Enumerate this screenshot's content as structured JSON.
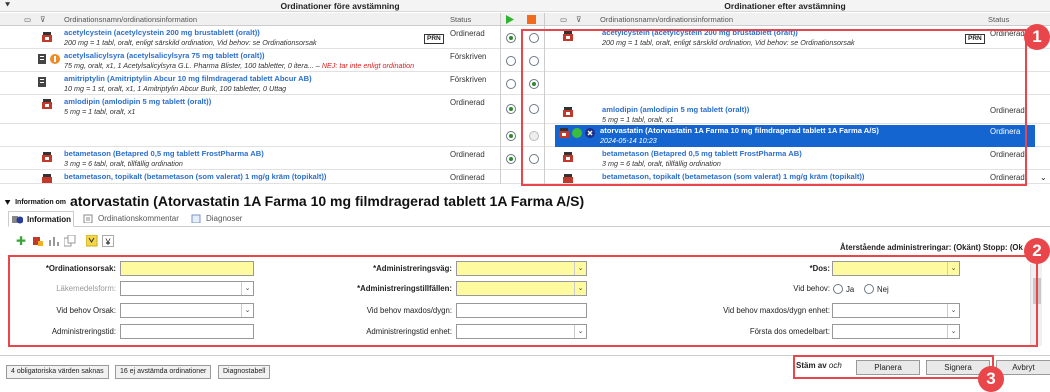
{
  "panels": {
    "left_title": "Ordinationer före avstämning",
    "right_title": "Ordinationer efter avstämning"
  },
  "columns": {
    "left_name": "Ordinationsnamn/ordinationsinformation",
    "left_status": "Status",
    "right_name": "Ordinationsnamn/ordinationsinformation",
    "right_status": "Status"
  },
  "rows": [
    {
      "left": {
        "name": "acetylcystein (acetylcystein 200 mg brustablett (oralt))",
        "sub": "200 mg = 1 tabl, oralt, enligt särskild ordination, Vid behov: se Ordinationsorsak",
        "status": "Ordinerad",
        "prn": "PRN"
      },
      "right": {
        "name": "acetylcystein (acetylcystein 200 mg brustablett (oralt))",
        "sub": "200 mg = 1 tabl, oralt, enligt särskild ordination, Vid behov: se Ordinationsorsak",
        "status": "Ordinerad",
        "prn": "PRN"
      }
    },
    {
      "left": {
        "name": "acetylsalicylsyra (acetylsalicylsyra 75 mg tablett (oralt))",
        "sub": "75 mg, oralt, x1, 1 Acetylsalicylsyra G.L. Pharma Blister, 100 tabletter, 0 itera... –",
        "warn": "NEJ: tar inte enligt ordination",
        "status": "Förskriven"
      }
    },
    {
      "left": {
        "name": "amitriptylin (Amitriptylin Abcur 10 mg filmdragerad tablett Abcur AB)",
        "sub": "10 mg = 1 st, oralt, x1, 1 Amitriptylin Abcur Burk, 100 tabletter, 0 Uttag",
        "status": "Förskriven"
      }
    },
    {
      "left": {
        "name": "amlodipin (amlodipin 5 mg tablett (oralt))",
        "sub": "5 mg = 1 tabl, oralt, x1",
        "status": "Ordinerad"
      },
      "right": {
        "name": "amlodipin (amlodipin 5 mg tablett (oralt))",
        "sub": "5 mg = 1 tabl, oralt, x1",
        "status": "Ordinerad"
      }
    },
    {
      "right": {
        "name": "atorvastatin (Atorvastatin 1A Farma 10 mg filmdragerad tablett 1A Farma A/S)",
        "sub": "2024-05-14 10:23",
        "status": "Ordinera"
      }
    },
    {
      "left": {
        "name": "betametason (Betapred 0,5 mg tablett FrostPharma AB)",
        "sub": "3 mg = 6 tabl, oralt, tillfällig ordination",
        "status": "Ordinerad"
      },
      "right": {
        "name": "betametason (Betapred 0,5 mg tablett FrostPharma AB)",
        "sub": "3 mg = 6 tabl, oralt, tillfällig ordination",
        "status": "Ordinerad"
      }
    },
    {
      "left": {
        "name": "betametason, topikalt (betametason (som valerat) 1 mg/g kräm (topikalt))",
        "status": "Ordinerad"
      },
      "right": {
        "name": "betametason, topikalt (betametason (som valerat) 1 mg/g kräm (topikalt))",
        "status": "Ordinerad"
      }
    }
  ],
  "badges": {
    "one": "1",
    "two": "2",
    "three": "3"
  },
  "info": {
    "prefix": "Information om",
    "title": "atorvastatin (Atorvastatin 1A Farma 10 mg filmdragerad tablett 1A Farma A/S)"
  },
  "tabs": [
    "Information",
    "Ordinationskommentar",
    "Diagnoser"
  ],
  "remaining_text": "Återstående administreringar: (Okänt)  Stopp: (Ok",
  "form": {
    "ordinationsorsak": "*Ordinationsorsak:",
    "administreringsvag": "*Administreringsväg:",
    "dos": "*Dos:",
    "lakemedelsform": "Läkemedelsform:",
    "administreringstillfallen": "*Administreringstillfällen:",
    "vid_behov": "Vid behov:",
    "ja": "Ja",
    "nej": "Nej",
    "vid_behov_orsak": "Vid behov Orsak:",
    "vid_behov_maxdos_dygn": "Vid behov maxdos/dygn:",
    "vid_behov_maxdos_enhet": "Vid behov maxdos/dygn enhet:",
    "administreringstid": "Administreringstid:",
    "administreringstid_enhet": "Administreringstid enhet:",
    "forsta_dos": "Första dos omedelbart:"
  },
  "bottom": {
    "btn1": "4 obligatoriska värden saknas",
    "btn2": "16 ej avstämda ordinationer",
    "btn3": "Diagnostabell",
    "stam_av": "Stäm av",
    "och": "och",
    "planera": "Planera",
    "signera": "Signera",
    "avbryt": "Avbryt"
  },
  "colors": {
    "accent": "#e8464a",
    "link": "#2a6fce",
    "selected": "#1565d0",
    "required": "#fdfaa0"
  }
}
